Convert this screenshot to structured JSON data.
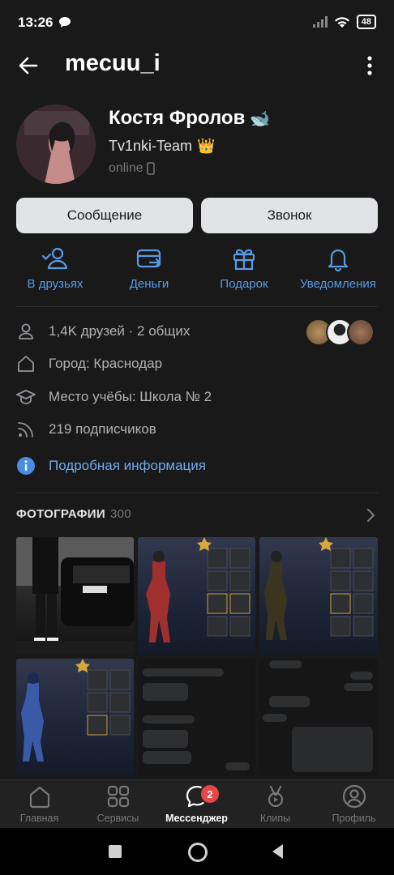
{
  "status_bar": {
    "time": "13:26",
    "battery": "48"
  },
  "header": {
    "username": "mecuu_i"
  },
  "profile": {
    "name": "Костя Фролов",
    "name_emoji": "🐋",
    "status": "Tv1nki-Team",
    "status_emoji": "👑",
    "online": "online"
  },
  "buttons": {
    "message": "Сообщение",
    "call": "Звонок"
  },
  "actions": [
    {
      "label": "В друзьях"
    },
    {
      "label": "Деньги"
    },
    {
      "label": "Подарок"
    },
    {
      "label": "Уведомления"
    }
  ],
  "info": {
    "friends": "1,4K друзей · 2 общих",
    "city": "Город: Краснодар",
    "school": "Место учёбы: Школа № 2",
    "followers": "219 подписчиков",
    "details_link": "Подробная информация"
  },
  "photos": {
    "title": "ФОТОГРАФИИ",
    "count": "300"
  },
  "bottom_nav": {
    "items": [
      {
        "label": "Главная"
      },
      {
        "label": "Сервисы"
      },
      {
        "label": "Мессенджер",
        "badge": "2"
      },
      {
        "label": "Клипы"
      },
      {
        "label": "Профиль"
      }
    ]
  },
  "colors": {
    "accent": "#71aaeb",
    "background": "#19191a",
    "badge": "#e64646"
  }
}
